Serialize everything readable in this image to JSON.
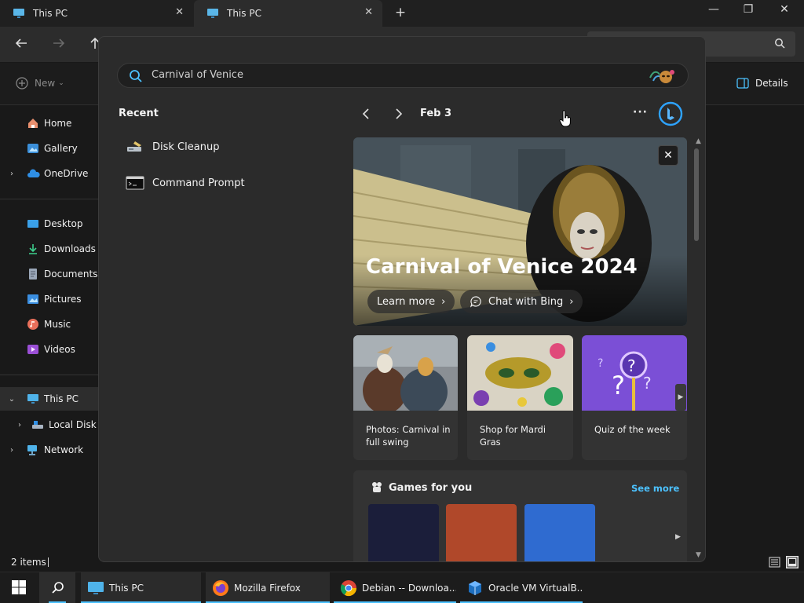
{
  "explorer": {
    "tabs": [
      {
        "label": "This PC",
        "icon": "monitor-icon"
      },
      {
        "label": "This PC",
        "icon": "monitor-icon"
      }
    ],
    "new_tab_glyph": "+",
    "toolbar": {
      "new_label": "New",
      "details_label": "Details"
    },
    "nav": {
      "home": "Home",
      "gallery": "Gallery",
      "onedrive": "OneDrive",
      "desktop": "Desktop",
      "downloads": "Downloads",
      "documents": "Documents",
      "pictures": "Pictures",
      "music": "Music",
      "videos": "Videos",
      "this_pc": "This PC",
      "local_disk": "Local Disk (C:)",
      "network": "Network"
    },
    "status": {
      "items": "2 items"
    }
  },
  "search_flyout": {
    "query": "Carnival of Venice",
    "recent_title": "Recent",
    "recent": [
      {
        "label": "Disk Cleanup",
        "icon": "disk-cleanup-icon"
      },
      {
        "label": "Command Prompt",
        "icon": "command-prompt-icon"
      }
    ],
    "date": "Feb 3",
    "more_glyph": "···",
    "hero": {
      "title": "Carnival of Venice 2024",
      "learn_more": "Learn more",
      "chat_with_bing": "Chat with Bing"
    },
    "cards": [
      {
        "label": "Photos: Carnival in full swing"
      },
      {
        "label": "Shop for Mardi Gras"
      },
      {
        "label": "Quiz of the week"
      }
    ],
    "games": {
      "title": "Games for you",
      "see_more": "See more"
    }
  },
  "taskbar": {
    "items": [
      {
        "label": "This PC",
        "icon": "file-explorer-icon"
      },
      {
        "label": "Mozilla Firefox",
        "icon": "firefox-icon"
      },
      {
        "label": "Debian -- Downloa...",
        "icon": "chrome-icon"
      },
      {
        "label": "Oracle VM VirtualB...",
        "icon": "virtualbox-icon"
      }
    ]
  },
  "colors": {
    "accent": "#4cc2ff",
    "flyout_bg": "#2b2b2b",
    "quiz_purple": "#7b4fd6"
  }
}
